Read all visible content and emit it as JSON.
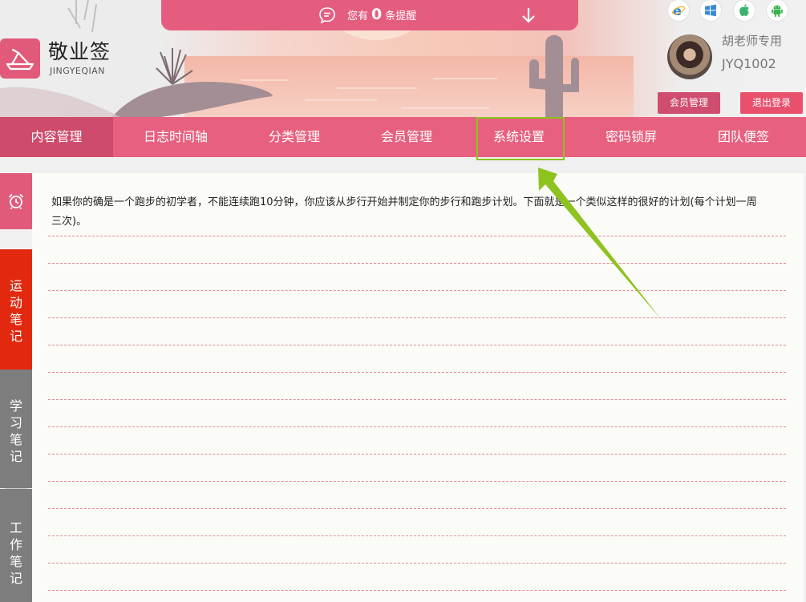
{
  "notice": {
    "prefix": "您有",
    "count": "0",
    "suffix": "条提醒"
  },
  "brand": {
    "name": "敬业签",
    "subtitle": "JINGYEQIAN"
  },
  "platforms": [
    "ie-icon",
    "windows-icon",
    "apple-icon",
    "android-icon"
  ],
  "user": {
    "name": "胡老师专用",
    "id": "JYQ1002"
  },
  "buttons": {
    "member": "会员管理",
    "logout": "退出登录"
  },
  "nav": {
    "items": [
      {
        "label": "内容管理",
        "active": true
      },
      {
        "label": "日志时间轴"
      },
      {
        "label": "分类管理"
      },
      {
        "label": "会员管理"
      },
      {
        "label": "系统设置",
        "highlighted": true
      },
      {
        "label": "密码锁屏"
      },
      {
        "label": "团队便签"
      }
    ]
  },
  "sidebar": {
    "tabs": [
      {
        "chars": [
          "运",
          "动",
          "笔",
          "记"
        ],
        "active": true
      },
      {
        "chars": [
          "学",
          "习",
          "笔",
          "记"
        ]
      },
      {
        "chars": [
          "工",
          "作",
          "笔",
          "记"
        ]
      }
    ]
  },
  "note": {
    "text": "如果你的确是一个跑步的初学者，不能连续跑10分钟，你应该从步行开始并制定你的步行和跑步计划。下面就是一个类似这样的很好的计划(每个计划一周三次)。"
  },
  "colors": {
    "accent": "#e7607f",
    "active_nav": "#ce4b6c",
    "sport_tab": "#e2290f",
    "inactive_tab": "#7d7d7d",
    "annotation": "#8dc21f"
  }
}
